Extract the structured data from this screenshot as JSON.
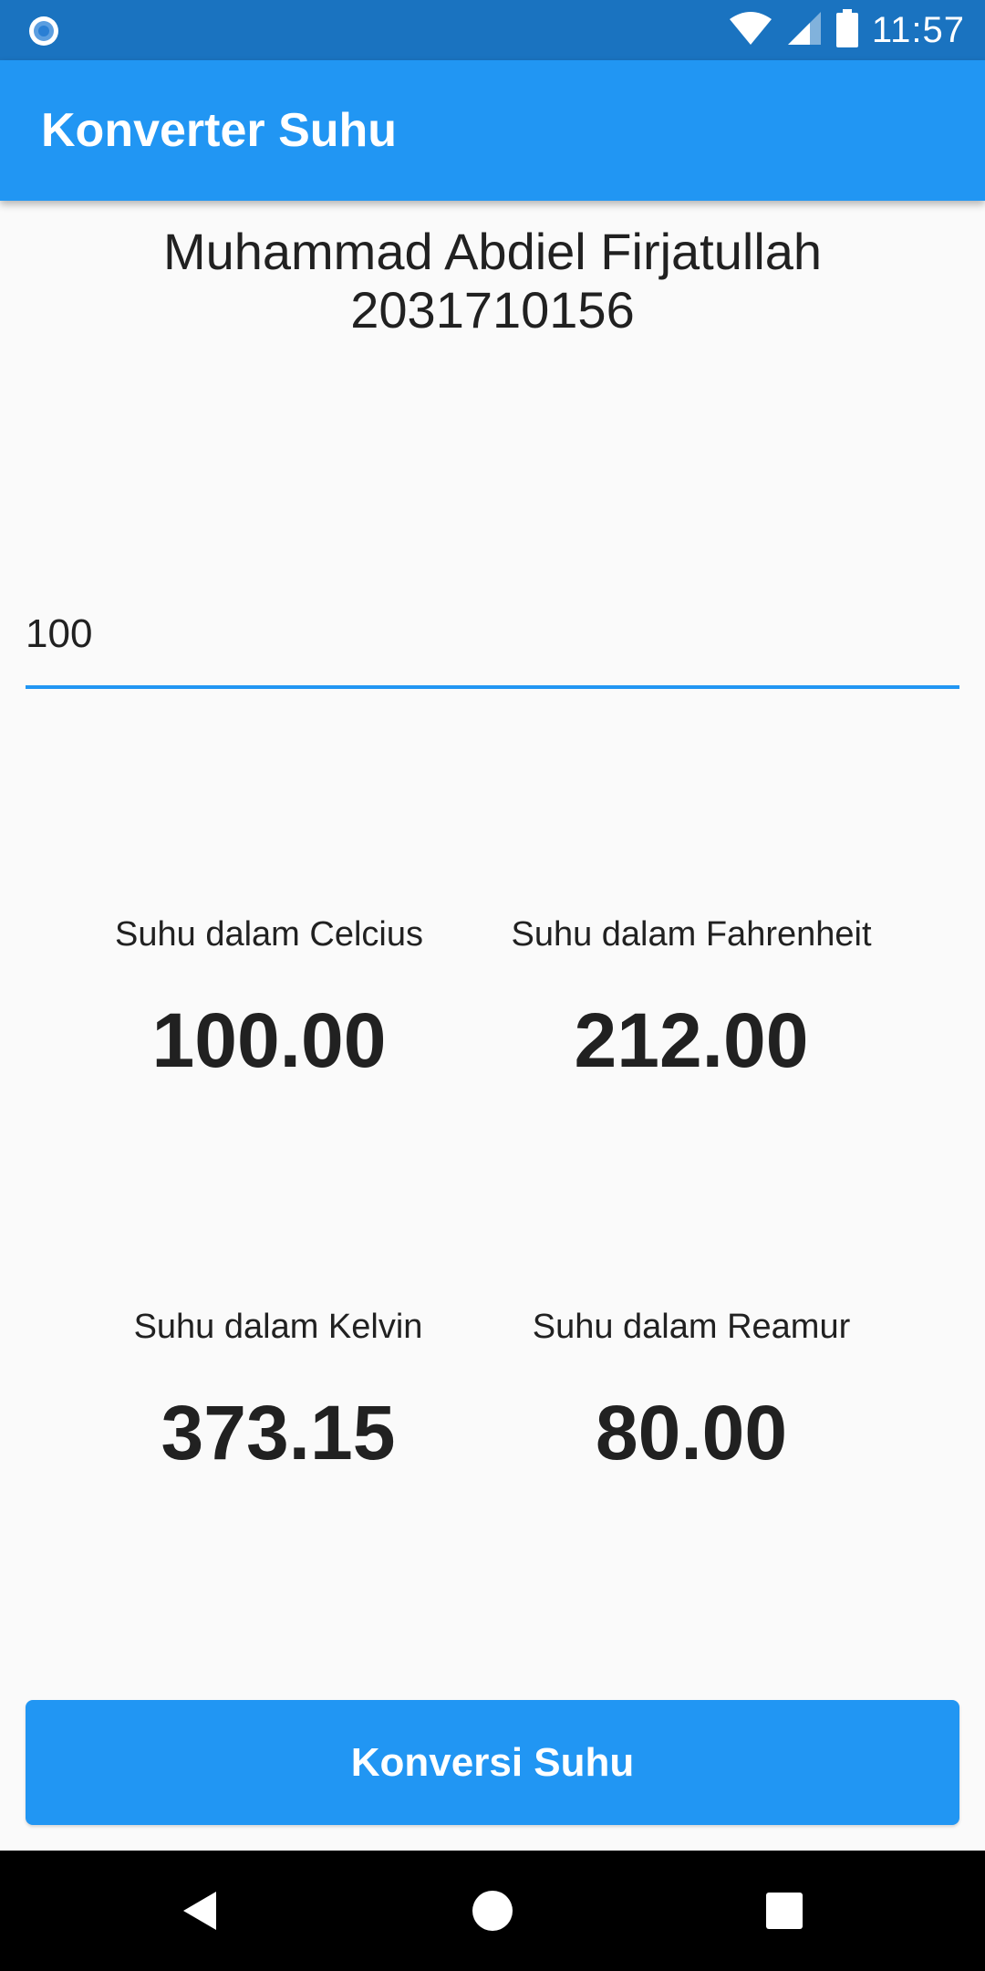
{
  "status_bar": {
    "time": "11:57",
    "icons": [
      "notification-dot-icon",
      "wifi-icon",
      "signal-icon",
      "battery-icon"
    ]
  },
  "app_bar": {
    "title": "Konverter Suhu"
  },
  "header": {
    "name": "Muhammad Abdiel Firjatullah",
    "id_number": "2031710156"
  },
  "input": {
    "value": "100"
  },
  "results": {
    "celcius": {
      "label": "Suhu dalam Celcius",
      "value": "100.00"
    },
    "fahrenheit": {
      "label": "Suhu dalam Fahrenheit",
      "value": "212.00"
    },
    "kelvin": {
      "label": "Suhu dalam Kelvin",
      "value": "373.15"
    },
    "reamur": {
      "label": "Suhu dalam Reamur",
      "value": "80.00"
    }
  },
  "button": {
    "label": "Konversi Suhu"
  },
  "nav_bar": {
    "icons": [
      "back-icon",
      "home-icon",
      "recents-icon"
    ]
  },
  "colors": {
    "primary": "#2196f3",
    "status_bar": "#1a73c0",
    "background": "#fafafa",
    "text": "#212121"
  }
}
